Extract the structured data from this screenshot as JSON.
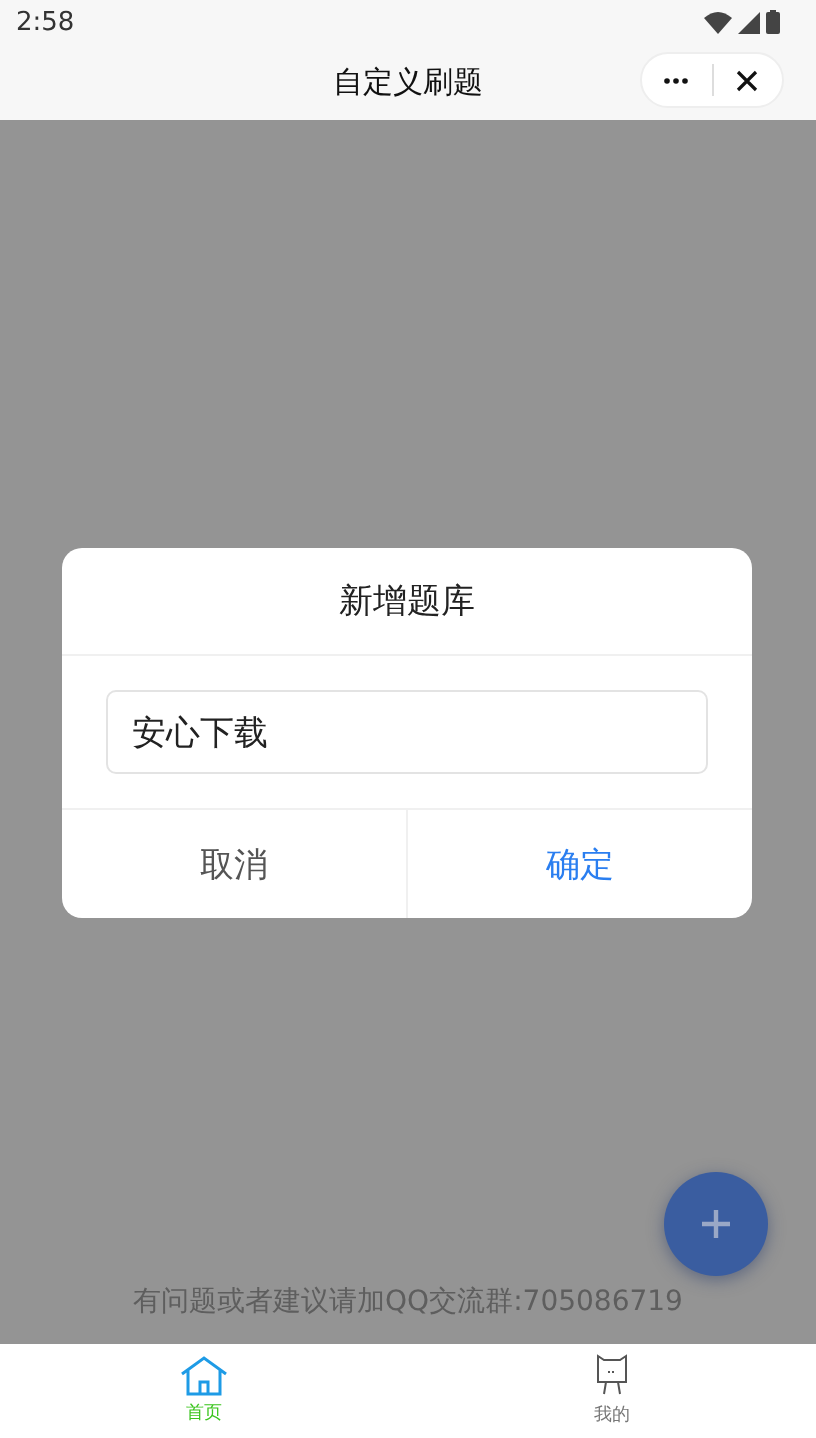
{
  "status_bar": {
    "time": "2:58"
  },
  "nav_bar": {
    "title": "自定义刷题"
  },
  "page": {
    "footer_text": "有问题或者建议请加QQ交流群:705086719"
  },
  "dialog": {
    "title": "新增题库",
    "input": {
      "value": "安心下载"
    },
    "buttons": [
      {
        "label": "取消",
        "kind": "cancel"
      },
      {
        "label": "确定",
        "kind": "confirm"
      }
    ]
  },
  "tabs": [
    {
      "label": "首页",
      "kind": "home",
      "selected": true
    },
    {
      "label": "我的",
      "kind": "profile",
      "selected": false
    }
  ]
}
